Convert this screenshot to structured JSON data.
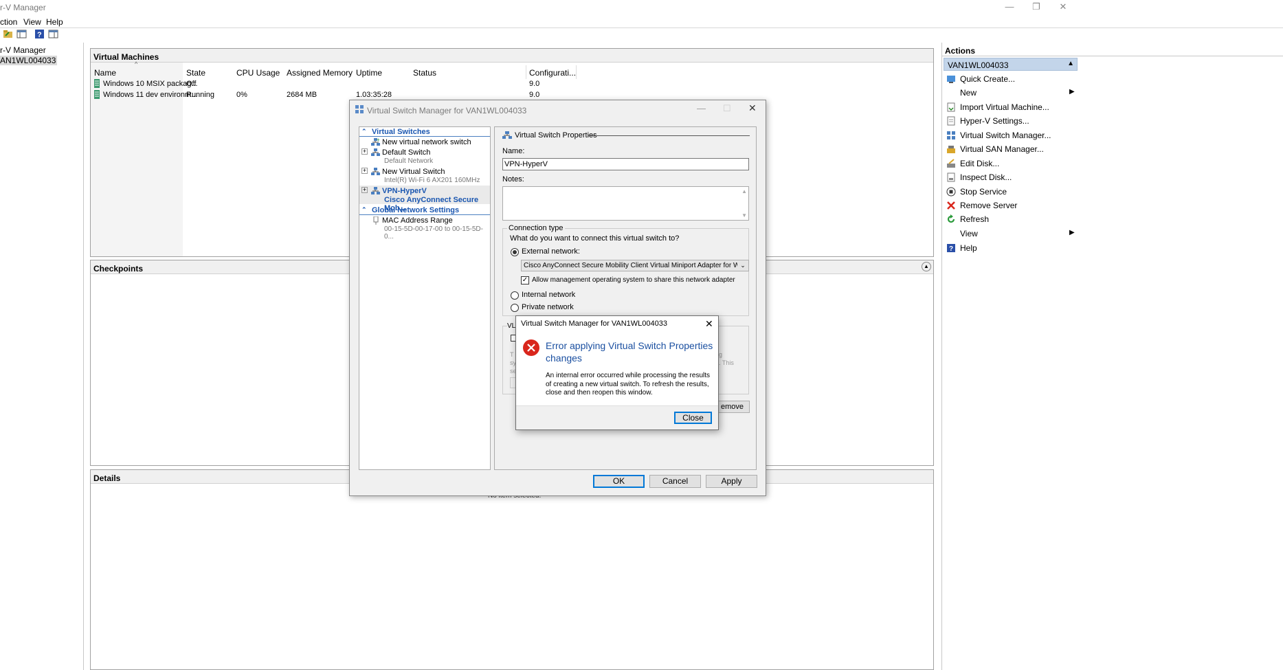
{
  "window": {
    "title": "r-V Manager",
    "minimize": "—",
    "restore": "❐",
    "close": "✕"
  },
  "menu": {
    "items": [
      "ction",
      "View",
      "Help"
    ]
  },
  "tree": {
    "items": [
      "r-V Manager",
      "AN1WL004033"
    ]
  },
  "vm_panel": {
    "title": "Virtual Machines",
    "columns": [
      "Name",
      "State",
      "CPU Usage",
      "Assigned Memory",
      "Uptime",
      "Status",
      "Configurati..."
    ],
    "rows": [
      [
        "Windows 10 MSIX packag...",
        "Off",
        "",
        "",
        "",
        "",
        "9.0"
      ],
      [
        "Windows 11 dev environm...",
        "Running",
        "0%",
        "2684 MB",
        "1.03:35:28",
        "",
        "9.0"
      ]
    ]
  },
  "checkpoints_panel": {
    "title": "Checkpoints"
  },
  "details_panel": {
    "title": "Details",
    "empty_text": "No item selected."
  },
  "actions": {
    "title": "Actions",
    "group": "VAN1WL004033",
    "items": [
      "Quick Create...",
      "New",
      "Import Virtual Machine...",
      "Hyper-V Settings...",
      "Virtual Switch Manager...",
      "Virtual SAN Manager...",
      "Edit Disk...",
      "Inspect Disk...",
      "Stop Service",
      "Remove Server",
      "Refresh",
      "View",
      "Help"
    ]
  },
  "vsm_dialog": {
    "title": "Virtual Switch Manager for VAN1WL004033",
    "tree": {
      "virtual_switches": "Virtual Switches",
      "new_switch": "New virtual network switch",
      "default_switch": "Default Switch",
      "default_switch_sub": "Default Network",
      "new_virtual_switch": "New Virtual Switch",
      "new_virtual_switch_sub": "Intel(R) Wi-Fi 6 AX201 160MHz",
      "vpn_switch": "VPN-HyperV",
      "vpn_switch_sub": "Cisco AnyConnect Secure Mob...",
      "global": "Global Network Settings",
      "mac": "MAC Address Range",
      "mac_sub": "00-15-5D-00-17-00 to 00-15-5D-0..."
    },
    "props": {
      "section": "Virtual Switch Properties",
      "name_label": "Name:",
      "name_value": "VPN-HyperV",
      "notes_label": "Notes:",
      "conn_type": "Connection type",
      "conn_question": "What do you want to connect this virtual switch to?",
      "external": "External network:",
      "adapter": "Cisco AnyConnect Secure Mobility Client Virtual Miniport Adapter for Window",
      "allow_mgmt": "Allow management operating system to share this network adapter",
      "internal": "Internal network",
      "private": "Private network",
      "vlan_fragment": "VL",
      "frag_t": "T",
      "frag_sy": "sy",
      "frag_se": "se",
      "frag_g": "g",
      "frag_this": ". This",
      "remove_fragment": "emove"
    },
    "ok": "OK",
    "cancel": "Cancel",
    "apply": "Apply"
  },
  "error_dialog": {
    "title": "Virtual Switch Manager for VAN1WL004033",
    "heading": "Error applying Virtual Switch Properties changes",
    "message": "An internal error occurred while processing the results of creating a new virtual switch. To refresh the results, close and then reopen this window.",
    "close_button": "Close"
  },
  "colors": {
    "accent": "#0066cc",
    "error": "#d9261c",
    "header_sel": "#c3d5ea"
  }
}
